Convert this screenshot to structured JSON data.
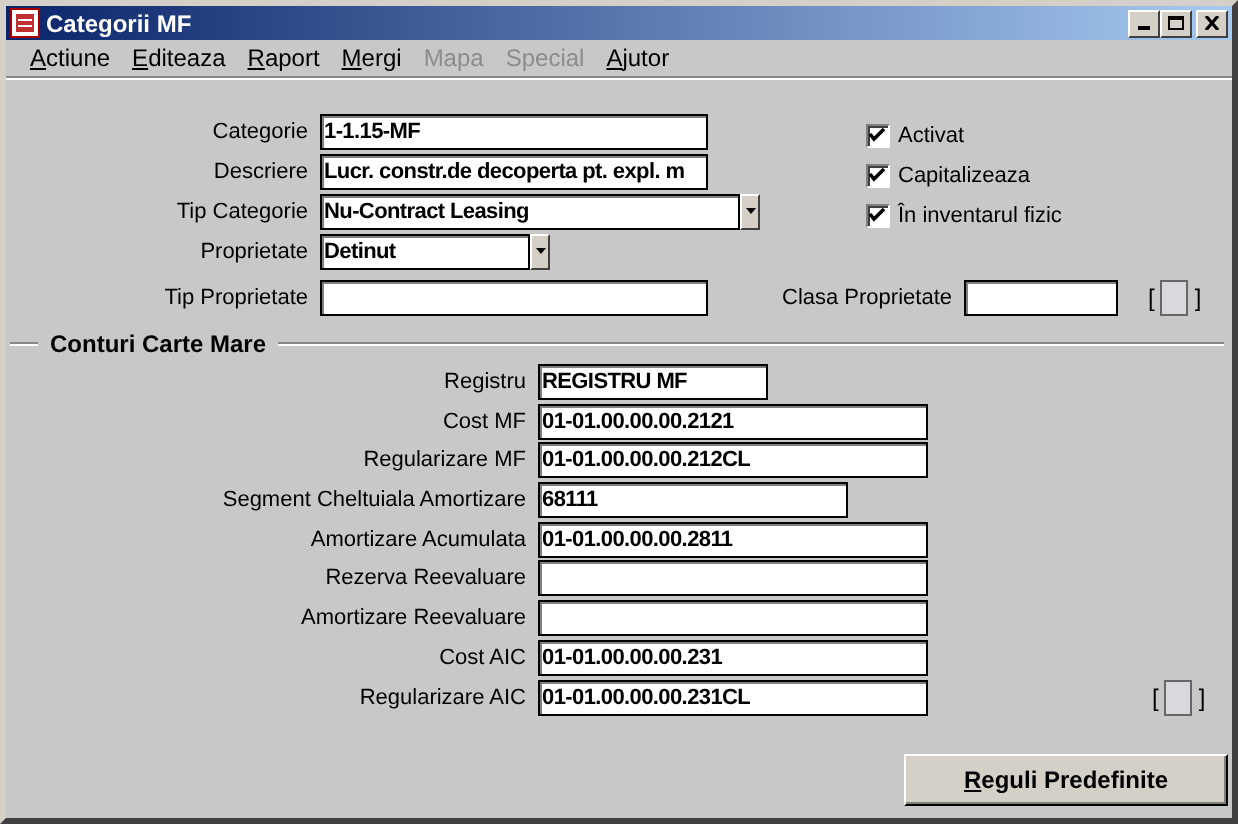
{
  "window": {
    "title": "Categorii MF"
  },
  "menu": [
    {
      "label": "Actiune",
      "disabled": false
    },
    {
      "label": "Editeaza",
      "disabled": false
    },
    {
      "label": "Raport",
      "disabled": false
    },
    {
      "label": "Mergi",
      "disabled": false
    },
    {
      "label": "Mapa",
      "disabled": true
    },
    {
      "label": "Special",
      "disabled": true
    },
    {
      "label": "Ajutor",
      "disabled": false
    }
  ],
  "category": {
    "fields": [
      {
        "label": "Categorie",
        "value": "1-1.15-MF",
        "kind": "text"
      },
      {
        "label": "Descriere",
        "value": "Lucr. constr.de decoperta pt. expl. m",
        "kind": "text"
      },
      {
        "label": "Tip Categorie",
        "value": "Nu-Contract Leasing",
        "kind": "dropdown"
      },
      {
        "label": "Proprietate",
        "value": "Detinut",
        "kind": "dropdown"
      },
      {
        "label": "Tip Proprietate",
        "kind": "text"
      }
    ],
    "checkboxes": [
      {
        "label": "Activat",
        "checked": true
      },
      {
        "label": "Capitalizeaza",
        "checked": true
      },
      {
        "label": "În inventarul fizic",
        "checked": true
      }
    ],
    "clasa_proprietate": {
      "label": "Clasa Proprietate"
    },
    "flex_field": {
      "open": "[",
      "close": "]"
    }
  },
  "ledger": {
    "title": "Conturi Carte Mare",
    "fields": [
      {
        "label": "Registru",
        "value": "REGISTRU MF"
      },
      {
        "label": "Cost MF",
        "value": "01-01.00.00.00.2121"
      },
      {
        "label": "Regularizare MF",
        "value": "01-01.00.00.00.212CL"
      },
      {
        "label": "Segment Cheltuiala Amortizare",
        "value": "68111"
      },
      {
        "label": "Amortizare Acumulata",
        "value": "01-01.00.00.00.2811"
      },
      {
        "label": "Rezerva Reevaluare"
      },
      {
        "label": "Amortizare Reevaluare"
      },
      {
        "label": "Cost AIC",
        "value": "01-01.00.00.00.231"
      },
      {
        "label": "Regularizare AIC",
        "value": "01-01.00.00.00.231CL"
      }
    ],
    "flex_field": {
      "open": "[",
      "close": "]"
    }
  },
  "buttons": [
    {
      "label": "Reguli Predefinite"
    }
  ]
}
